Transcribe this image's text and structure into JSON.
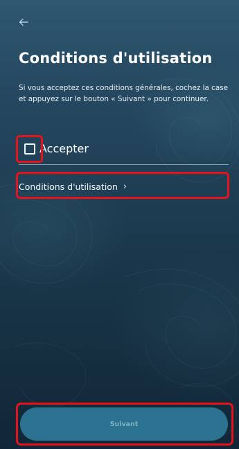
{
  "header": {
    "back_icon": "arrow-left-icon",
    "title": "Conditions d'utilisation"
  },
  "main": {
    "description": "Si vous acceptez ces conditions générales, cochez la case et appuyez sur le bouton « Suivant » pour continuer.",
    "accept": {
      "label": "Accepter",
      "checked": false
    },
    "terms_link": {
      "label": "Conditions d'utilisation",
      "chevron": "›"
    }
  },
  "footer": {
    "next_label": "Suivant"
  },
  "colors": {
    "highlight": "#e5141c",
    "button": "#2b7290",
    "button_text": "#7fb3c6"
  }
}
